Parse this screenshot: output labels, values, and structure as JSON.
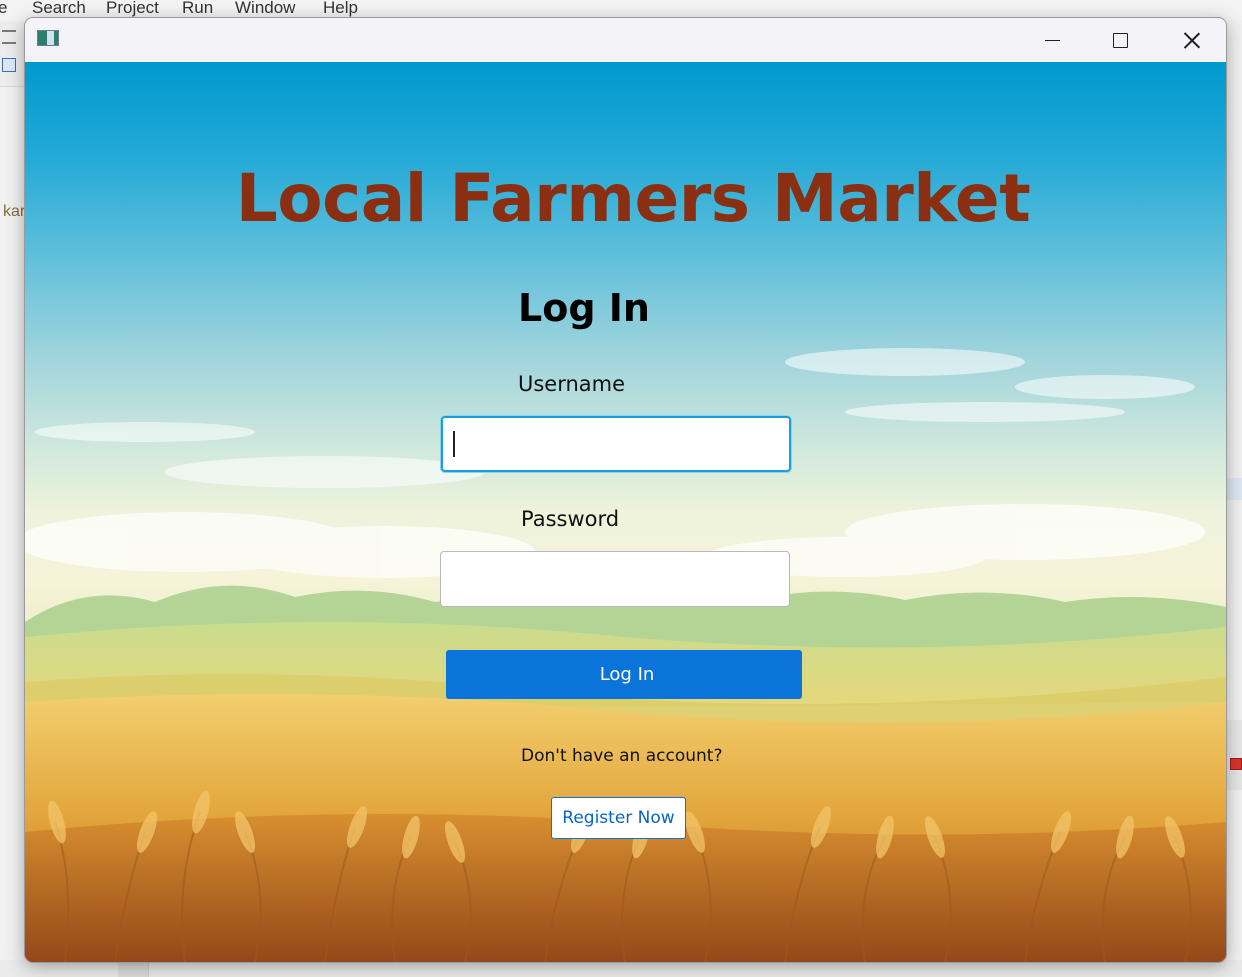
{
  "ide": {
    "menu": [
      "e",
      "Search",
      "Project",
      "Run",
      "Window",
      "Help"
    ],
    "side_text": "kar"
  },
  "window": {
    "controls": {
      "minimize_icon": "minimize-icon",
      "maximize_icon": "maximize-icon",
      "close_icon": "close-icon"
    }
  },
  "app": {
    "title": "Local Farmers Market",
    "title_color": "#8a2f12",
    "heading": "Log In",
    "username_label": "Username",
    "username_value": "",
    "password_label": "Password",
    "password_value": "",
    "login_button": "Log In",
    "account_prompt": "Don't have an account?",
    "register_button": "Register Now",
    "accent_color": "#0a74da"
  }
}
